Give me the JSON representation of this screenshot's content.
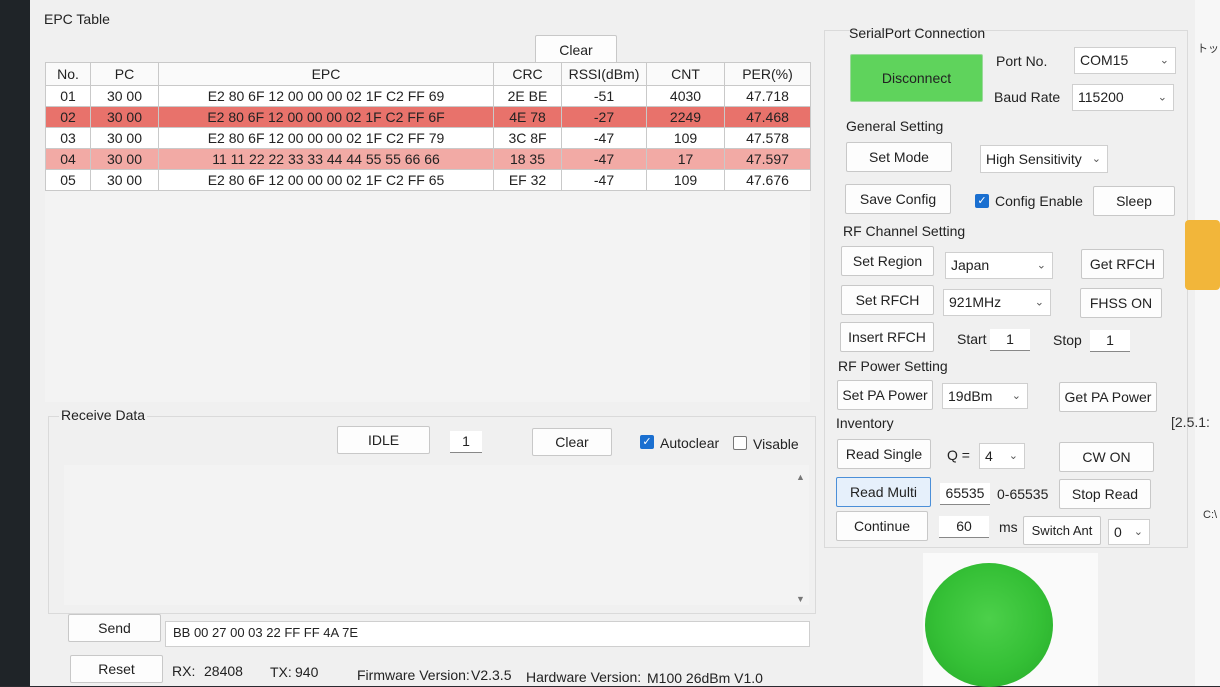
{
  "epc_table": {
    "title": "EPC Table",
    "clear_label": "Clear",
    "columns": [
      "No.",
      "PC",
      "EPC",
      "CRC",
      "RSSI(dBm)",
      "CNT",
      "PER(%)"
    ],
    "rows": [
      {
        "no": "01",
        "pc": "30 00",
        "epc": "E2 80 6F 12 00 00 00 02 1F C2 FF 69",
        "crc": "2E BE",
        "rssi": "-51",
        "cnt": "4030",
        "per": "47.718",
        "highlight": "none"
      },
      {
        "no": "02",
        "pc": "30 00",
        "epc": "E2 80 6F 12 00 00 00 02 1F C2 FF 6F",
        "crc": "4E 78",
        "rssi": "-27",
        "cnt": "2249",
        "per": "47.468",
        "highlight": "strong"
      },
      {
        "no": "03",
        "pc": "30 00",
        "epc": "E2 80 6F 12 00 00 00 02 1F C2 FF 79",
        "crc": "3C 8F",
        "rssi": "-47",
        "cnt": "109",
        "per": "47.578",
        "highlight": "none"
      },
      {
        "no": "04",
        "pc": "30 00",
        "epc": "11 11 22 22 33 33 44 44 55 55 66 66",
        "crc": "18 35",
        "rssi": "-47",
        "cnt": "17",
        "per": "47.597",
        "highlight": "light"
      },
      {
        "no": "05",
        "pc": "30 00",
        "epc": "E2 80 6F 12 00 00 00 02 1F C2 FF 65",
        "crc": "EF 32",
        "rssi": "-47",
        "cnt": "109",
        "per": "47.676",
        "highlight": "none"
      }
    ]
  },
  "receive": {
    "title": "Receive Data",
    "idle_label": "IDLE",
    "count_value": "1",
    "clear_label": "Clear",
    "autoclear_label": "Autoclear",
    "autoclear_checked": true,
    "visable_label": "Visable",
    "visable_checked": false
  },
  "bottom": {
    "send_label": "Send",
    "send_value": "BB 00 27 00 03 22 FF FF 4A 7E",
    "reset_label": "Reset",
    "rx_label": "RX:",
    "rx_value": "28408",
    "tx_label": "TX:",
    "tx_value": "940",
    "firmware_label": "Firmware Version:",
    "firmware_value": "V2.3.5",
    "hardware_label": "Hardware Version:",
    "hardware_value": "M100 26dBm V1.0"
  },
  "serial": {
    "title": "SerialPort Connection",
    "disconnect_label": "Disconnect",
    "port_label": "Port No.",
    "port_value": "COM15",
    "baud_label": "Baud Rate",
    "baud_value": "115200"
  },
  "general": {
    "title": "General Setting",
    "set_mode_label": "Set Mode",
    "mode_value": "High Sensitivity",
    "save_config_label": "Save Config",
    "config_enable_label": "Config Enable",
    "config_enable_checked": true,
    "sleep_label": "Sleep"
  },
  "rf_channel": {
    "title": "RF Channel Setting",
    "set_region_label": "Set Region",
    "region_value": "Japan",
    "get_rfch_label": "Get RFCH",
    "set_rfch_label": "Set RFCH",
    "rfch_value": "921MHz",
    "fhss_label": "FHSS ON",
    "insert_rfch_label": "Insert RFCH",
    "start_label": "Start",
    "start_value": "1",
    "stop_label": "Stop",
    "stop_value": "1"
  },
  "rf_power": {
    "title": "RF Power Setting",
    "set_pa_label": "Set PA Power",
    "pa_value": "19dBm",
    "get_pa_label": "Get PA Power"
  },
  "inventory": {
    "title": "Inventory",
    "read_single_label": "Read Single",
    "q_label": "Q =",
    "q_value": "4",
    "cw_on_label": "CW ON",
    "read_multi_label": "Read Multi",
    "multi_count_value": "65535",
    "multi_range_label": "0-65535",
    "stop_read_label": "Stop Read",
    "continue_label": "Continue",
    "continue_value": "60",
    "ms_label": "ms",
    "switch_ant_label": "Switch Ant",
    "ant_value": "0"
  },
  "status_led": {
    "color": "#35c036"
  },
  "edge_text": {
    "top": "トップ",
    "version": "[2.5.1:",
    "drive": "C:\\"
  },
  "colors": {
    "row_strong": "#e8726b",
    "row_light": "#f2aaa5",
    "disconnect_bg": "#5fd35c",
    "checkbox_on": "#1a6fd0"
  }
}
